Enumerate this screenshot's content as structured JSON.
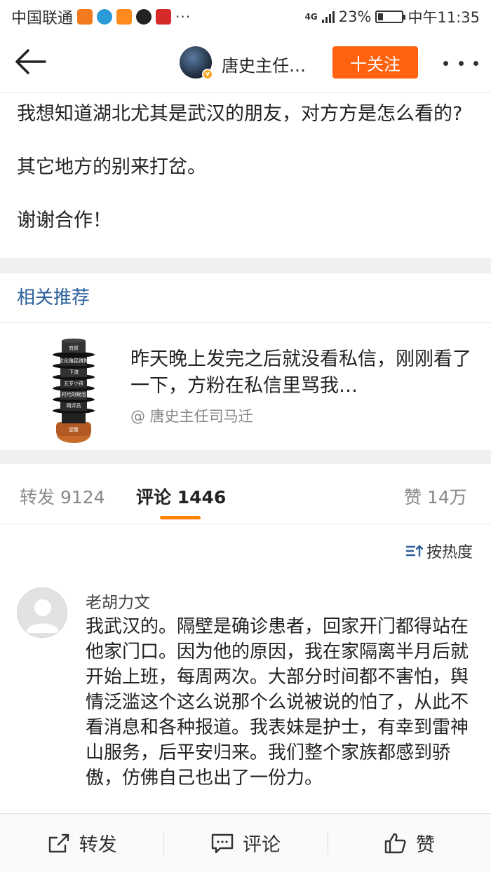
{
  "status_bar": {
    "carrier": "中国联通",
    "network": "4G",
    "battery_pct": "23%",
    "battery_level": 0.23,
    "time": "中午11:35"
  },
  "nav": {
    "username": "唐史主任…",
    "follow_label": "十关注"
  },
  "post": {
    "paragraphs": [
      "我想知道湖北尤其是武汉的朋友，对方方是怎么看的?",
      "其它地方的别来打岔。",
      "谢谢合作！"
    ]
  },
  "related": {
    "header": "相关推荐",
    "title": "昨天晚上发完之后就没看私信，刚刚看了一下，方粉在私信里骂我…",
    "source": "@ 唐史主任司马迁",
    "thumb_hats": [
      "穷屌",
      "文化殖民蹲狗",
      "下流",
      "五岁小孩",
      "时代的眼泪",
      "网评员",
      "",
      "逆鳖"
    ]
  },
  "tabs": {
    "repost": "转发 9124",
    "comment": "评论 1446",
    "like": "赞 14万"
  },
  "sort": {
    "label": "按热度"
  },
  "comment": {
    "author": "老胡力文",
    "text": "我武汉的。隔壁是确诊患者，回家开门都得站在他家门口。因为他的原因，我在家隔离半月后就开始上班，每周两次。大部分时间都不害怕，舆情泛滥这个这么说那个么说被说的怕了，从此不看消息和各种报道。我表妹是护士，有幸到雷神山服务，后平安归来。我们整个家族都感到骄傲，仿佛自己也出了一份力。"
  },
  "bottom_bar": {
    "repost": "转发",
    "comment": "评论",
    "like": "赞"
  },
  "colors": {
    "follow": "#ff6310",
    "link": "#2a5f9a",
    "tab_indicator": "#ff8200"
  }
}
